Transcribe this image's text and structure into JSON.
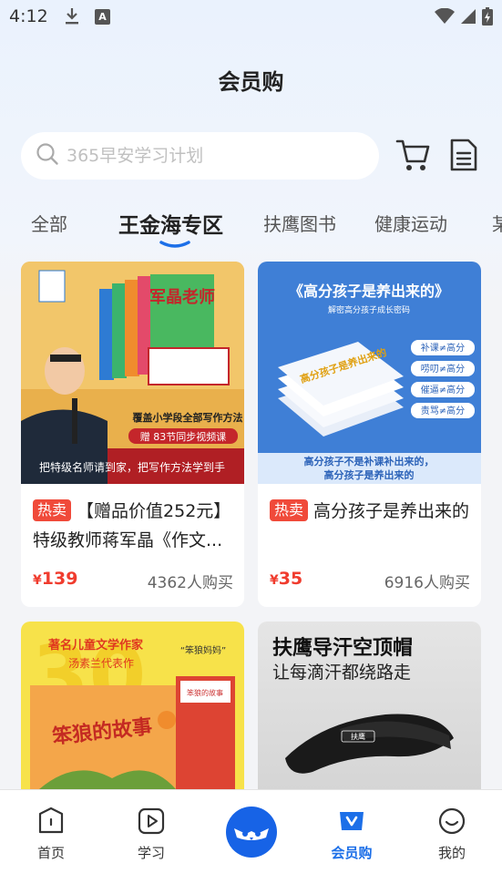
{
  "status_bar": {
    "time": "4:12",
    "a_label": "A"
  },
  "header": {
    "title": "会员购"
  },
  "search": {
    "placeholder": "365早安学习计划"
  },
  "tabs": [
    {
      "label": "全部",
      "active": false
    },
    {
      "label": "王金海专区",
      "active": true
    },
    {
      "label": "扶鹰图书",
      "active": false
    },
    {
      "label": "健康运动",
      "active": false
    }
  ],
  "products": [
    {
      "badge": "热卖",
      "title": "【赠品价值252元】特级教师蒋军晶《作文...",
      "currency": "¥",
      "price": "139",
      "sales": "4362人购买",
      "image": {
        "book_title": "军晶老师",
        "banner_line1": "覆盖小学段全部写作方法",
        "banner_line2": "赠 83节同步视频课",
        "footer": "把特级名师请到家，把写作方法学到手"
      }
    },
    {
      "badge": "热卖",
      "title": "高分孩子是养出来的",
      "currency": "¥",
      "price": "35",
      "sales": "6916人购买",
      "image": {
        "headline": "《高分孩子是养出来的》",
        "subline": "解密高分孩子成长密码",
        "book_title": "高分孩子是养出来的",
        "tags": [
          "补课≠高分",
          "唠叨≠高分",
          "催逼≠高分",
          "责骂≠高分"
        ],
        "footer_line1": "高分孩子不是补课补出来的，",
        "footer_line2": "高分孩子是养出来的"
      }
    },
    {
      "image": {
        "line1": "著名儿童文学作家",
        "line2": "汤素兰代表作",
        "quote": "“笨狼妈妈”",
        "book_title": "笨狼的故事",
        "box_text": "笨狼的故事"
      }
    },
    {
      "image": {
        "title": "扶鹰导汗空顶帽",
        "subtitle": "让每滴汗都绕路走",
        "logo": "扶鹰"
      }
    }
  ],
  "bottom_nav": [
    {
      "label": "首页",
      "icon": "home-icon",
      "active": false
    },
    {
      "label": "学习",
      "icon": "play-icon",
      "active": false
    },
    {
      "label": "会员购",
      "icon": "vip-shop-icon",
      "active": true
    },
    {
      "label": "我的",
      "icon": "profile-icon",
      "active": false
    }
  ],
  "colors": {
    "accent": "#1c6fe8",
    "hot": "#f04a3a",
    "price": "#f03c2e"
  }
}
